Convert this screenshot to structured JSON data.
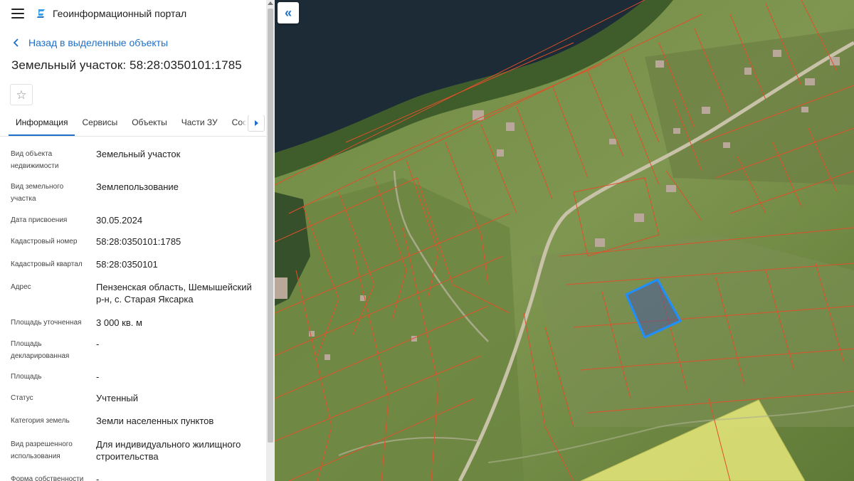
{
  "app": {
    "title": "Геоинформационный портал"
  },
  "nav": {
    "back_label": "Назад в выделенные объекты"
  },
  "page": {
    "title": "Земельный участок: 58:28:0350101:1785"
  },
  "tabs": [
    {
      "label": "Информация",
      "active": true
    },
    {
      "label": "Сервисы",
      "active": false
    },
    {
      "label": "Объекты",
      "active": false
    },
    {
      "label": "Части ЗУ",
      "active": false
    },
    {
      "label": "Соста",
      "active": false
    }
  ],
  "properties": [
    {
      "label": "Вид объекта недвижимости",
      "value": "Земельный участок"
    },
    {
      "label": "Вид земельного участка",
      "value": "Землепользование"
    },
    {
      "label": "Дата присвоения",
      "value": "30.05.2024"
    },
    {
      "label": "Кадастровый номер",
      "value": "58:28:0350101:1785"
    },
    {
      "label": "Кадастровый квартал",
      "value": "58:28:0350101"
    },
    {
      "label": "Адрес",
      "value": "Пензенская область, Шемышейский р-н, с. Старая Яксарка"
    },
    {
      "label": "Площадь уточненная",
      "value": "3 000 кв. м"
    },
    {
      "label": "Площадь декларированная",
      "value": "-"
    },
    {
      "label": "Площадь",
      "value": "-"
    },
    {
      "label": "Статус",
      "value": "Учтенный"
    },
    {
      "label": "Категория земель",
      "value": "Земли населенных пунктов"
    },
    {
      "label": "Вид разрешенного использования",
      "value": "Для индивидуального жилищного строительства"
    },
    {
      "label": "Форма собственности",
      "value": "-"
    }
  ],
  "icons": {
    "menu": "hamburger-icon",
    "logo": "portal-logo-icon",
    "back": "chevron-left-icon",
    "favorite": "star-icon",
    "tabs_scroll": "chevron-right-icon",
    "collapse": "double-chevron-left-icon"
  },
  "colors": {
    "accent": "#1e6fc7",
    "parcel_border": "#e0502a",
    "selected_parcel": "#1e8fff",
    "zone_fill": "#e8e87a",
    "water": "#1c2b36"
  }
}
